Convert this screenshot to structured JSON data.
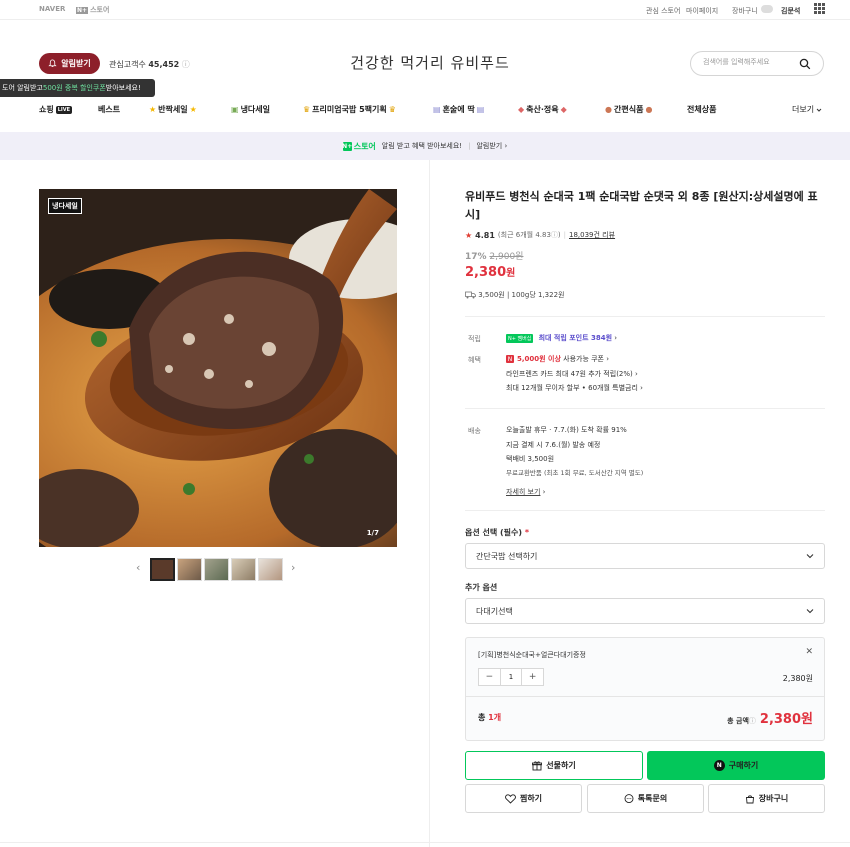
{
  "topbar": {
    "naver": "NAVER",
    "store_box": "N+",
    "store": "스토어",
    "links": [
      "관심 스토어",
      "마이페이지",
      "장바구니"
    ],
    "user": "김문석"
  },
  "header": {
    "alarm_button": "알림받기",
    "follower_label": "관심고객수",
    "follower_count": "45,452",
    "tooltip_pre": "도어 알림받고 ",
    "tooltip_hl": "500원 중복 할인쿠폰",
    "tooltip_post": " 받아보세요!",
    "store_title": "건강한 먹거리 유비푸드",
    "search_placeholder": "검색어를 입력해주세요"
  },
  "nav": {
    "items": [
      {
        "label": "쇼핑",
        "badge": "LIVE"
      },
      {
        "label": "베스트"
      },
      {
        "label": "반짝세일",
        "pre": "★",
        "post": "★"
      },
      {
        "label": "냉다세일",
        "pre": "▣"
      },
      {
        "label": "프리미엄국밥 5팩기획",
        "pre": "♛",
        "post": "♛"
      },
      {
        "label": "혼술에 딱",
        "pre": "▤",
        "post": "▤"
      },
      {
        "label": "축산·정육",
        "pre": "◆",
        "post": "◆"
      },
      {
        "label": "간편식품",
        "pre": "●",
        "post": "●"
      },
      {
        "label": "전체상품"
      },
      {
        "label": "더보기"
      }
    ]
  },
  "banner": {
    "brand_box": "N+",
    "brand": "스토어",
    "text": "알림 받고 혜택 받아보세요!",
    "divider": "|",
    "link": "알림받기"
  },
  "gallery": {
    "badge": "냉다세일",
    "counter": "1/7",
    "thumbnails": 5,
    "active_index": 0
  },
  "product": {
    "title": "유비푸드 병천식 순대국 1팩 순대국밥 순댓국 외 8종 [원산지:상세설명에 표시]",
    "rating": "4.81",
    "rating_recent": "(최근 6개월 4.83",
    "reviews": "18,039건 리뷰",
    "discount_pct": "17%",
    "original_price": "2,900원",
    "price": "2,380",
    "price_unit": "원",
    "shipping_summary": "3,500원 | 100g당 1,322원"
  },
  "benefits": {
    "point_label": "적립",
    "point_badge": "N+ 멤버십",
    "point_text": "최대 적립 포인트 384원",
    "benefit_label": "혜택",
    "coupon_badge": "N",
    "coupon_text": "5,000원 이상",
    "coupon_suffix": " 사용가능 쿠폰",
    "card_text": "라인프렌즈 카드 최대 47원 추가 적립(2%)",
    "installment_text": "최대 12개월 무이자 할부 • 60개월 특별금리"
  },
  "delivery": {
    "label": "배송",
    "line1": "오늘출발 휴무 · 7.7.(화) 도착 확률 91%",
    "line2": "지금 결제 시 7.6.(월) 발송 예정",
    "line3": "택배비 3,500원",
    "line4": "무료교환반품 (최초 1회 무료, 도서산간 지역 별도)",
    "more": "자세히 보기"
  },
  "options": {
    "required_label": "옵션 선택 (필수)",
    "required_mark": "*",
    "required_value": "간단국밥 선택하기",
    "extra_label": "추가 옵션",
    "extra_value": "다대기선택",
    "selected_name": "[기획]병천식순대국+얼큰다대기증정",
    "quantity": "1",
    "item_price": "2,380원",
    "total_label": "총",
    "total_count": "1개",
    "total_amount_label": "총 금액",
    "total_amount": "2,380원"
  },
  "actions": {
    "gift": "선물하기",
    "buy": "구매하기",
    "wish": "찜하기",
    "talk": "톡톡문의",
    "cart": "장바구니"
  },
  "colors": {
    "accent_red": "#e0323e",
    "naver_green": "#03c75a",
    "alarm_bg": "#8d1f2a"
  }
}
